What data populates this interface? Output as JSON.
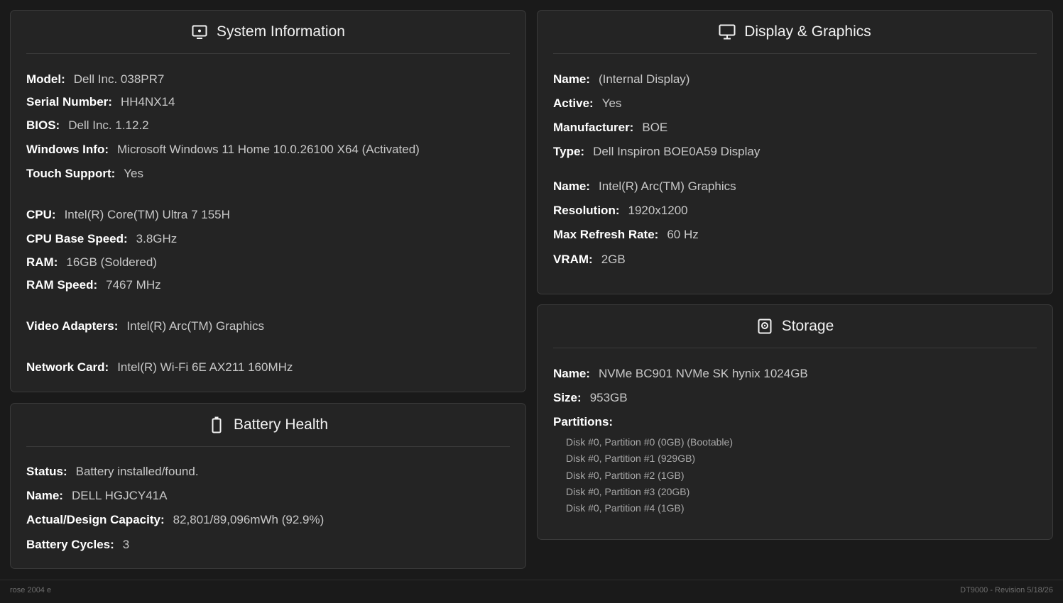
{
  "system": {
    "title": "System Information",
    "icon": "monitor-dot-icon",
    "rows": [
      {
        "label": "Model:",
        "value": "Dell Inc. 038PR7"
      },
      {
        "label": "Serial Number:",
        "value": "HH4NX14"
      },
      {
        "label": "BIOS:",
        "value": "Dell Inc. 1.12.2"
      },
      {
        "label": "Windows Info:",
        "value": "Microsoft Windows 11 Home 10.0.26100 X64 (Activated)"
      },
      {
        "label": "Touch Support:",
        "value": "Yes"
      },
      {
        "label": "CPU:",
        "value": "Intel(R) Core(TM) Ultra 7 155H"
      },
      {
        "label": "CPU Base Speed:",
        "value": "3.8GHz"
      },
      {
        "label": "RAM:",
        "value": "16GB (Soldered)"
      },
      {
        "label": "RAM Speed:",
        "value": "7467 MHz"
      },
      {
        "label": "Video Adapters:",
        "value": "Intel(R) Arc(TM) Graphics"
      },
      {
        "label": "Network Card:",
        "value": "Intel(R) Wi-Fi 6E AX211 160MHz"
      }
    ]
  },
  "battery": {
    "title": "Battery Health",
    "icon": "battery-icon",
    "rows": [
      {
        "label": "Status:",
        "value": "Battery installed/found."
      },
      {
        "label": "Name:",
        "value": "DELL HGJCY41A"
      },
      {
        "label": "Actual/Design Capacity:",
        "value": "82,801/89,096mWh (92.9%)"
      },
      {
        "label": "Battery Cycles:",
        "value": "3"
      }
    ]
  },
  "display": {
    "title": "Display & Graphics",
    "icon": "monitor-icon",
    "rows": [
      {
        "label": "Name:",
        "value": "(Internal Display)"
      },
      {
        "label": "Active:",
        "value": "Yes"
      },
      {
        "label": "Manufacturer:",
        "value": "BOE"
      },
      {
        "label": "Type:",
        "value": "Dell Inspiron BOE0A59 Display"
      },
      {
        "label": "Name:",
        "value": "Intel(R) Arc(TM) Graphics"
      },
      {
        "label": "Resolution:",
        "value": "1920x1200"
      },
      {
        "label": "Max Refresh Rate:",
        "value": "60 Hz"
      },
      {
        "label": "VRAM:",
        "value": "2GB"
      }
    ]
  },
  "storage": {
    "title": "Storage",
    "icon": "hard-drive-icon",
    "rows": [
      {
        "label": "Name:",
        "value": "NVMe BC901 NVMe SK hynix 1024GB"
      },
      {
        "label": "Size:",
        "value": "953GB"
      }
    ],
    "partitions_label": "Partitions:",
    "partitions": [
      "Disk #0, Partition #0 (0GB) (Bootable)",
      "Disk #0, Partition #1 (929GB)",
      "Disk #0, Partition #2 (1GB)",
      "Disk #0, Partition #3 (20GB)",
      "Disk #0, Partition #4 (1GB)"
    ]
  },
  "footer": {
    "left": "rose 2004 e",
    "right": "DT9000 - Revision 5/18/26"
  }
}
